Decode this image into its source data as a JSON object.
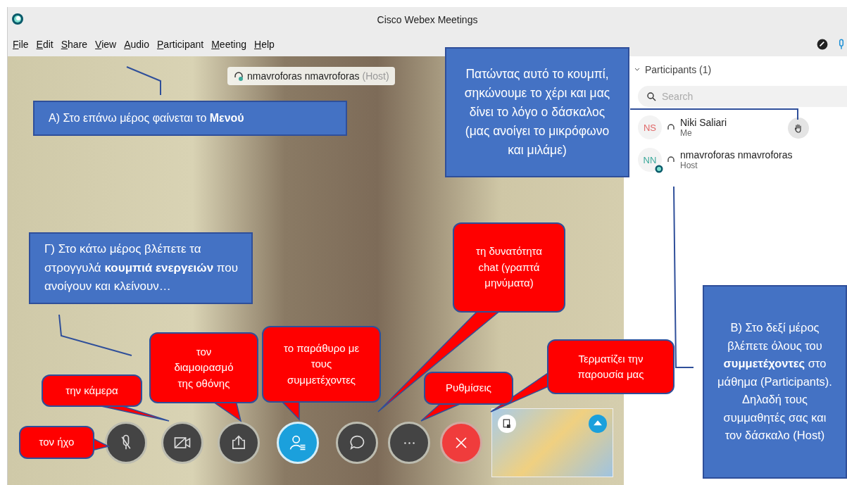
{
  "window": {
    "title": "Cisco Webex Meetings"
  },
  "menu": [
    {
      "label": "File"
    },
    {
      "label": "Edit"
    },
    {
      "label": "Share"
    },
    {
      "label": "View"
    },
    {
      "label": "Audio"
    },
    {
      "label": "Participant"
    },
    {
      "label": "Meeting"
    },
    {
      "label": "Help"
    }
  ],
  "video": {
    "speaker_name": "nmavroforas nmavroforas",
    "speaker_role": "(Host)"
  },
  "controls": [
    {
      "kind": "mic",
      "selected": false
    },
    {
      "kind": "camera",
      "selected": false
    },
    {
      "kind": "share",
      "selected": false
    },
    {
      "kind": "participants",
      "selected": true
    },
    {
      "kind": "chat",
      "selected": false
    },
    {
      "kind": "more",
      "selected": false
    },
    {
      "kind": "end",
      "selected": false
    }
  ],
  "participants_panel": {
    "title": "Participants (1)",
    "expanded": true,
    "search_placeholder": "Search",
    "participants": [
      {
        "initials": "NS",
        "name": "Niki Saliari",
        "role": "Me",
        "color": "#e06666",
        "host": false,
        "hand_button": true
      },
      {
        "initials": "NN",
        "name": "nmavroforas nmavroforas",
        "role": "Host",
        "color": "#3aa89a",
        "host": true,
        "hand_button": false
      }
    ]
  },
  "callouts": [
    {
      "kind": "note",
      "text": "Α) Στο επάνω μέρος φαίνεται το **Μενού**"
    },
    {
      "kind": "note",
      "text": "Πατώντας αυτό το κουμπί, σηκώνουμε το χέρι και μας δίνει το λόγο ο δάσκαλος (μας ανοίγει το μικρόφωνο και μιλάμε)"
    },
    {
      "kind": "note",
      "text": "Γ) Στο κάτω μέρος βλέπετε τα στρογγυλά **κουμπιά ενεργειών** που ανοίγουν και κλείνουν…"
    },
    {
      "kind": "note",
      "text": "Β) Στο δεξί μέρος βλέπετε όλους του **συμμετέχοντες** στο μάθημα (Participants). Δηλαδή τους συμμαθητές σας και τον δάσκαλο (Host)"
    },
    {
      "kind": "bubble",
      "text": "τον ήχο"
    },
    {
      "kind": "bubble",
      "text": "την κάμερα"
    },
    {
      "kind": "bubble",
      "text": "τον διαμοιρασμό της οθόνης"
    },
    {
      "kind": "bubble",
      "text": "το παράθυρο με τους συμμετέχοντες"
    },
    {
      "kind": "bubble",
      "text": "τη δυνατότητα chat (γραπτά μηνύματα)"
    },
    {
      "kind": "bubble",
      "text": "Ρυθμίσεις"
    },
    {
      "kind": "bubble",
      "text": "Τερματίζει την παρουσία μας"
    }
  ]
}
